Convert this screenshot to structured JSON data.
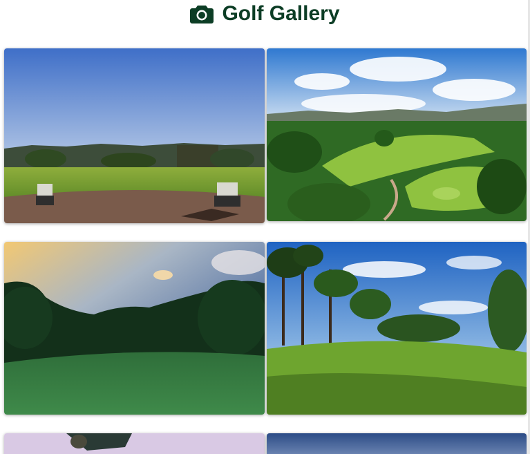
{
  "header": {
    "title": "Golf Gallery",
    "icon": "camera-icon",
    "title_color": "#0c3d25"
  },
  "gallery": {
    "items": [
      {
        "subject": "golf-carts-on-path-at-sunrise"
      },
      {
        "subject": "aerial-golf-course-with-mountains"
      },
      {
        "subject": "golf-green-at-sunset-with-trees"
      },
      {
        "subject": "fairway-with-pine-trees-blue-sky"
      },
      {
        "subject": "golfer-swinging-partial"
      },
      {
        "subject": "course-partial-blue-sky"
      }
    ]
  }
}
